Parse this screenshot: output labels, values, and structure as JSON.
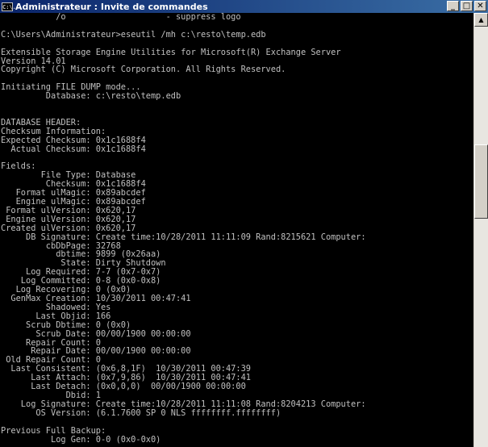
{
  "window": {
    "title": "Administrateur : Invite de commandes",
    "icon": "cmd-icon",
    "icon_text": "C:\\.",
    "buttons": {
      "minimize": "_",
      "maximize": "□",
      "close": "✕"
    }
  },
  "console": {
    "lines": [
      "           /o                    - suppress logo",
      "",
      "C:\\Users\\Administrateur>eseutil /mh c:\\resto\\temp.edb",
      "",
      "Extensible Storage Engine Utilities for Microsoft(R) Exchange Server",
      "Version 14.01",
      "Copyright (C) Microsoft Corporation. All Rights Reserved.",
      "",
      "Initiating FILE DUMP mode...",
      "         Database: c:\\resto\\temp.edb",
      "",
      "",
      "DATABASE HEADER:",
      "Checksum Information:",
      "Expected Checksum: 0x1c1688f4",
      "  Actual Checksum: 0x1c1688f4",
      "",
      "Fields:",
      "        File Type: Database",
      "         Checksum: 0x1c1688f4",
      "   Format ulMagic: 0x89abcdef",
      "   Engine ulMagic: 0x89abcdef",
      " Format ulVersion: 0x620,17",
      " Engine ulVersion: 0x620,17",
      "Created ulVersion: 0x620,17",
      "     DB Signature: Create time:10/28/2011 11:11:09 Rand:8215621 Computer:",
      "         cbDbPage: 32768",
      "           dbtime: 9899 (0x26aa)",
      "            State: Dirty Shutdown",
      "     Log Required: 7-7 (0x7-0x7)",
      "    Log Committed: 0-8 (0x0-0x8)",
      "   Log Recovering: 0 (0x0)",
      "  GenMax Creation: 10/30/2011 00:47:41",
      "         Shadowed: Yes",
      "       Last Objid: 166",
      "     Scrub Dbtime: 0 (0x0)",
      "       Scrub Date: 00/00/1900 00:00:00",
      "     Repair Count: 0",
      "      Repair Date: 00/00/1900 00:00:00",
      " Old Repair Count: 0",
      "  Last Consistent: (0x6,8,1F)  10/30/2011 00:47:39",
      "      Last Attach: (0x7,9,86)  10/30/2011 00:47:41",
      "      Last Detach: (0x0,0,0)  00/00/1900 00:00:00",
      "             Dbid: 1",
      "    Log Signature: Create time:10/28/2011 11:11:08 Rand:8204213 Computer:",
      "       OS Version: (6.1.7600 SP 0 NLS ffffffff.ffffffff)",
      "",
      "Previous Full Backup:",
      "          Log Gen: 0-0 (0x0-0x0)"
    ]
  },
  "scrollbar": {
    "up_arrow": "▲"
  }
}
